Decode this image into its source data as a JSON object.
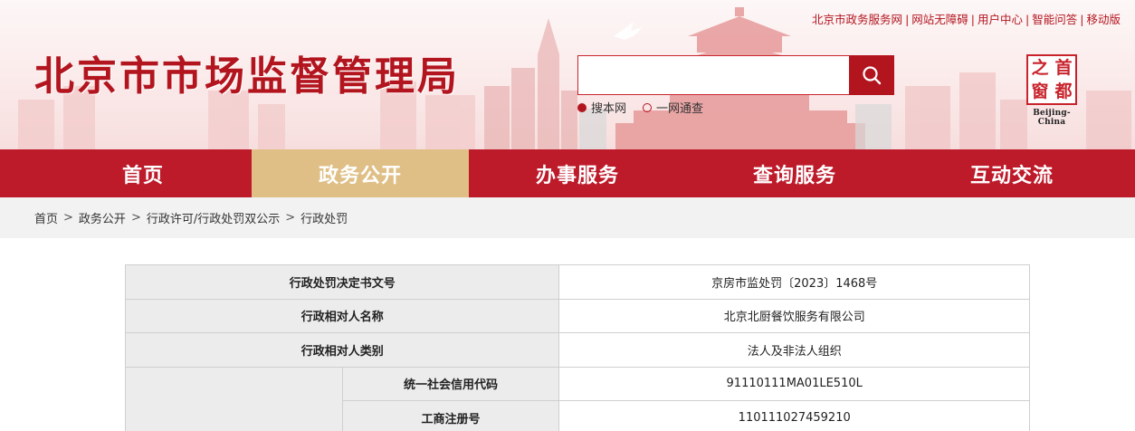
{
  "top_links": [
    "北京市政务服务网",
    "网站无障碍",
    "用户中心",
    "智能问答",
    "移动版"
  ],
  "site_title": "北京市市场监督管理局",
  "search": {
    "placeholder": "",
    "options": [
      {
        "label": "搜本网",
        "selected": true
      },
      {
        "label": "一网通查",
        "selected": false
      }
    ],
    "icon": "search-icon"
  },
  "logo": {
    "chars": [
      "之",
      "首",
      "窗",
      "都"
    ],
    "caption": "Beijing-China"
  },
  "nav": [
    "首页",
    "政务公开",
    "办事服务",
    "查询服务",
    "互动交流"
  ],
  "nav_active": "政务公开",
  "breadcrumb": [
    "首页",
    "政务公开",
    "行政许可/行政处罚双公示",
    "行政处罚"
  ],
  "table": {
    "rows": [
      {
        "label": "行政处罚决定书文号",
        "value": "京房市监处罚〔2023〕1468号"
      },
      {
        "label": "行政相对人名称",
        "value": "北京北厨餐饮服务有限公司"
      },
      {
        "label": "行政相对人类别",
        "value": "法人及非法人组织"
      }
    ],
    "sub_rows": [
      {
        "label": "统一社会信用代码",
        "value": "91110111MA01LE510L"
      },
      {
        "label": "工商注册号",
        "value": "110111027459210"
      }
    ]
  },
  "colors": {
    "brand_red": "#bd1a2a",
    "nav_active": "#dfbf86"
  }
}
